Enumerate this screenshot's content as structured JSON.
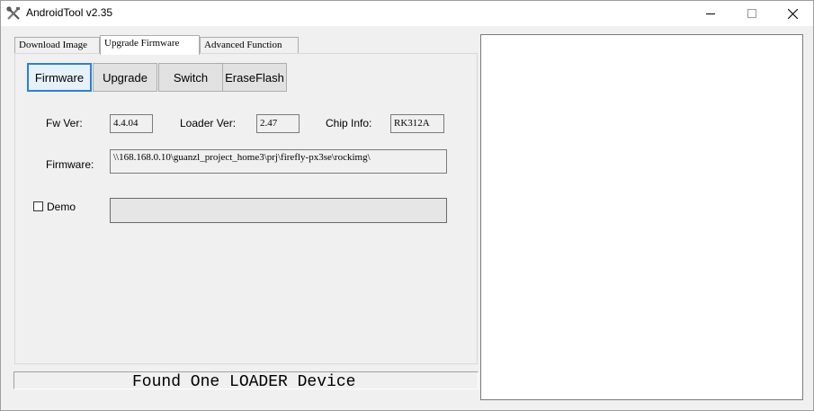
{
  "window": {
    "title": "AndroidTool v2.35",
    "app_icon": "crossed-tools-icon",
    "controls": [
      "minimize-icon",
      "maximize-icon",
      "close-icon"
    ]
  },
  "tabs": [
    {
      "label": "Download Image",
      "active": false
    },
    {
      "label": "Upgrade Firmware",
      "active": true
    },
    {
      "label": "Advanced Function",
      "active": false
    }
  ],
  "buttons": {
    "firmware": "Firmware",
    "upgrade": "Upgrade",
    "switch": "Switch",
    "erase_flash": "EraseFlash"
  },
  "info": {
    "fw_ver_label": "Fw Ver:",
    "fw_ver_value": "4.4.04",
    "loader_ver_label": "Loader Ver:",
    "loader_ver_value": "2.47",
    "chip_info_label": "Chip Info:",
    "chip_info_value": "RK312A",
    "firmware_label": "Firmware:",
    "firmware_path": "\\\\168.168.0.10\\guanzl_project_home3\\prj\\firefly-px3se\\rockimg\\"
  },
  "demo": {
    "label": "Demo",
    "checked": false
  },
  "status": {
    "message": "Found One LOADER Device"
  }
}
